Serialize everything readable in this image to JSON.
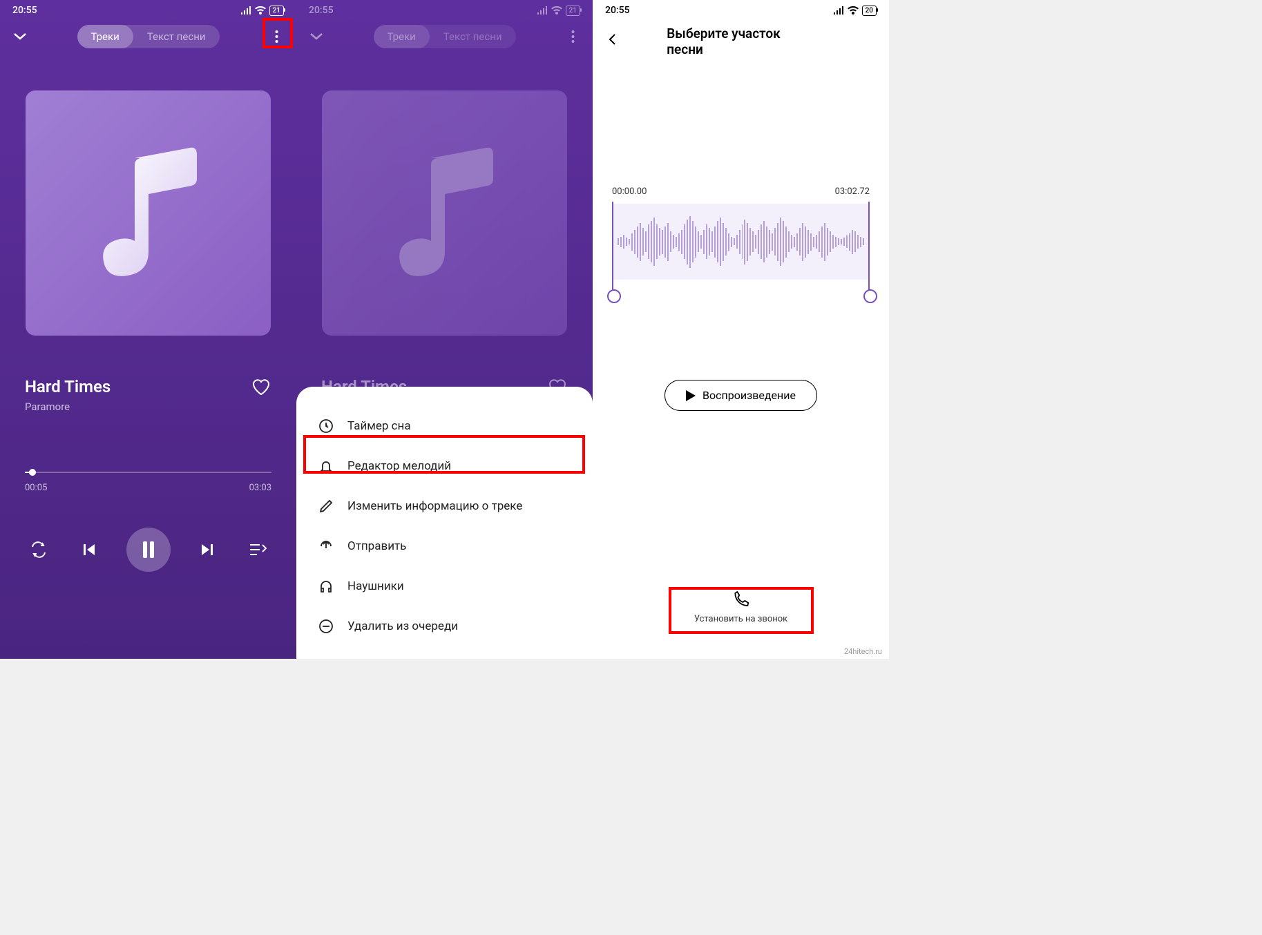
{
  "status": {
    "time": "20:55",
    "battery1": "21",
    "battery3": "20"
  },
  "tabs": {
    "tracks": "Треки",
    "lyrics": "Текст песни"
  },
  "track": {
    "title": "Hard Times",
    "artist": "Paramore",
    "current": "00:05",
    "duration": "03:03"
  },
  "menu": {
    "items": [
      {
        "icon": "clock",
        "label": "Таймер сна"
      },
      {
        "icon": "bell",
        "label": "Редактор мелодий"
      },
      {
        "icon": "pencil",
        "label": "Изменить информацию о треке"
      },
      {
        "icon": "share",
        "label": "Отправить"
      },
      {
        "icon": "headphones",
        "label": "Наушники"
      },
      {
        "icon": "minus",
        "label": "Удалить из очереди"
      }
    ]
  },
  "editor": {
    "title": "Выберите участок песни",
    "start": "00:00.00",
    "end": "03:02.72",
    "play_label": "Воспроизведение",
    "action_label": "Установить на звонок"
  },
  "watermark": "24hitech.ru"
}
